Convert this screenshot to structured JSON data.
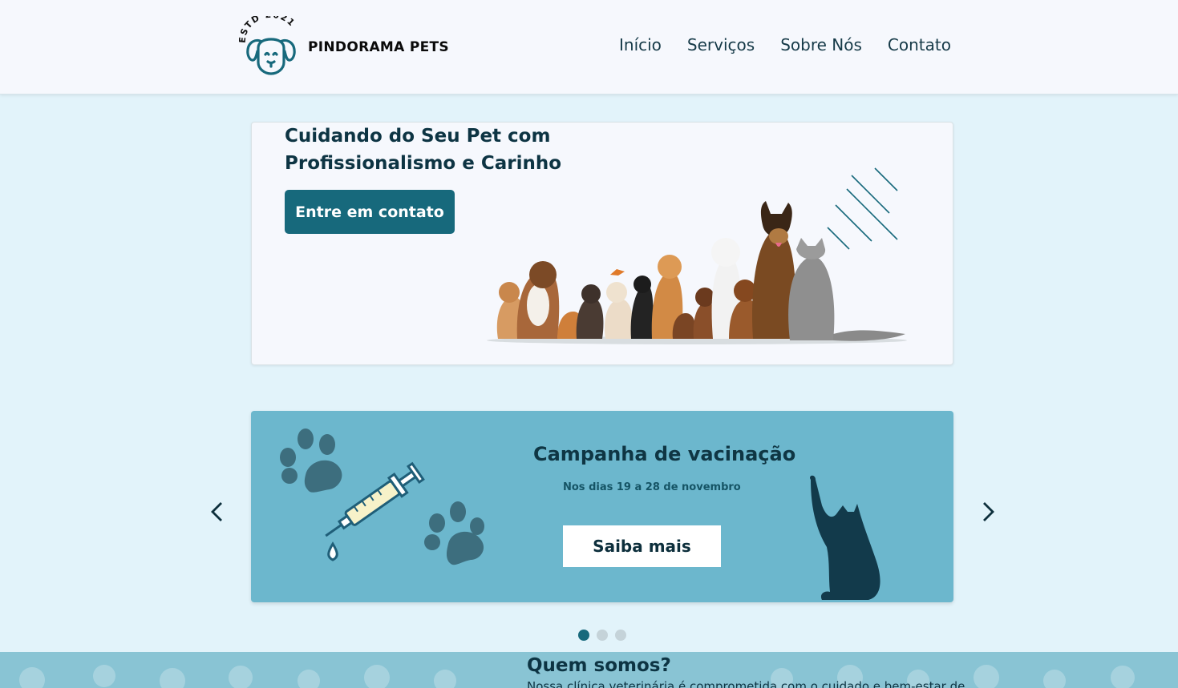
{
  "header": {
    "logo_text": "ESTD 2021",
    "brand": "PINDORAMA PETS",
    "nav": [
      {
        "label": "Início"
      },
      {
        "label": "Serviços"
      },
      {
        "label": "Sobre Nós"
      },
      {
        "label": "Contato"
      }
    ]
  },
  "hero": {
    "title_line1": "Cuidando do Seu Pet com",
    "title_line2": "Profissionalismo e Carinho",
    "button_label": "Entre em contato"
  },
  "carousel": {
    "title": "Campanha de vacinação",
    "subtitle": "Nos dias 19 a 28 de novembro",
    "button_label": "Saiba mais",
    "slide_count": 3,
    "active_slide": 1
  },
  "about": {
    "title": "Quem somos?",
    "text": "Nossa clínica veterinária é comprometida com o cuidado e bem-estar de"
  },
  "colors": {
    "primary": "#17697c",
    "dark": "#0d3443",
    "page_bg": "#e2f3fa",
    "carousel_bg": "#6cb7cd",
    "about_bg": "#89c4d4"
  }
}
